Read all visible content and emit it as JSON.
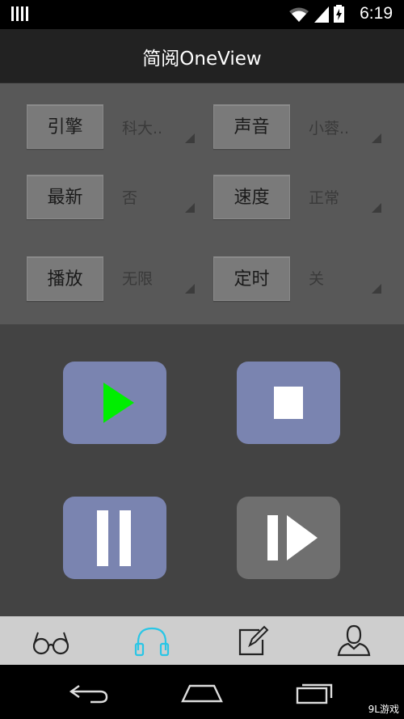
{
  "status_bar": {
    "time": "6:19"
  },
  "app": {
    "title": "简阅OneView"
  },
  "settings": {
    "engine": {
      "label": "引擎",
      "value": "科大.."
    },
    "voice": {
      "label": "声音",
      "value": "小蓉.."
    },
    "latest": {
      "label": "最新",
      "value": "否"
    },
    "speed": {
      "label": "速度",
      "value": "正常"
    },
    "playback": {
      "label": "播放",
      "value": "无限"
    },
    "timer": {
      "label": "定时",
      "value": "关"
    }
  },
  "player": {
    "play_icon": "play-icon",
    "stop_icon": "stop-icon",
    "pause_icon": "pause-icon",
    "next_icon": "next-icon",
    "play_color": "#00ee00",
    "button_color": "#7a84b0"
  },
  "tabs": [
    {
      "icon": "glasses-icon"
    },
    {
      "icon": "headphones-icon",
      "active": true,
      "color": "#29c6e6"
    },
    {
      "icon": "edit-icon"
    },
    {
      "icon": "profile-icon"
    }
  ],
  "watermark": {
    "text": "9L游戏"
  }
}
